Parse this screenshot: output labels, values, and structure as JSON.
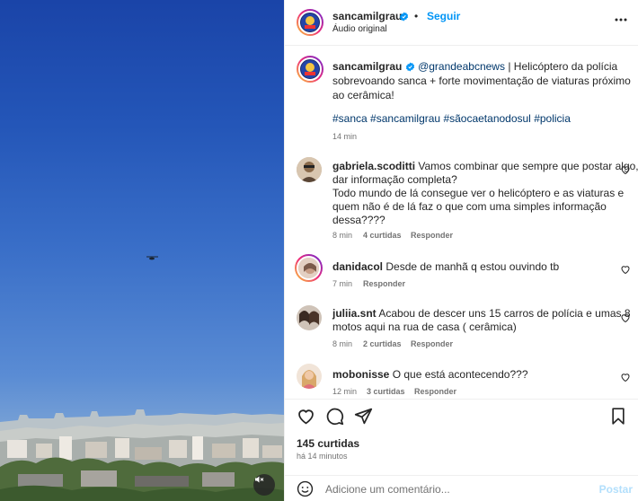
{
  "header": {
    "username": "sancamilgrau",
    "separator": "•",
    "follow_label": "Seguir",
    "subtitle": "Áudio original",
    "more_icon": "more-horizontal-icon"
  },
  "caption": {
    "username": "sancamilgrau",
    "mention": "@grandeabcnews",
    "text_line1": "| Helicóptero da polícia",
    "text_line2": "sobrevoando sanca + forte movimentação de viaturas próximo",
    "text_line3": "ao cerâmica!",
    "hashtags": [
      "#sanca",
      "#sancamilgrau",
      "#sãocaetanodosul",
      "#policia"
    ],
    "time": "14 min"
  },
  "comments": [
    {
      "username": "gabriela.scoditti",
      "lines": [
        "Vamos combinar que sempre que postar algo,",
        "dar informação completa?",
        "Todo mundo de lá consegue ver o helicóptero e as viaturas e",
        "quem não é de lá faz o que com uma simples informação",
        "dessa????"
      ],
      "time": "8 min",
      "likes": "4 curtidas",
      "reply": "Responder"
    },
    {
      "username": "danidacol",
      "lines": [
        "Desde de manhã q estou ouvindo tb"
      ],
      "time": "7 min",
      "likes": "",
      "reply": "Responder"
    },
    {
      "username": "juliia.snt",
      "lines": [
        "Acabou de descer uns 15 carros de polícia e umas 8",
        "motos aqui na rua de casa ( cerâmica)"
      ],
      "time": "8 min",
      "likes": "2 curtidas",
      "reply": "Responder"
    },
    {
      "username": "mobonisse",
      "lines": [
        "O que está acontecendo???"
      ],
      "time": "12 min",
      "likes": "3 curtidas",
      "reply": "Responder"
    }
  ],
  "actions": {
    "like_icon": "heart-icon",
    "comment_icon": "comment-icon",
    "share_icon": "send-icon",
    "save_icon": "bookmark-icon",
    "likes": "145 curtidas",
    "posted": "há 14 minutos"
  },
  "comment_box": {
    "emoji_icon": "emoji-icon",
    "placeholder": "Adicione um comentário...",
    "post_label": "Postar"
  },
  "media": {
    "mute_icon": "muted-speaker-icon"
  },
  "colors": {
    "accent": "#0095f6",
    "link": "#00376b",
    "muted": "#737373",
    "post_disabled": "#b2dffc"
  }
}
